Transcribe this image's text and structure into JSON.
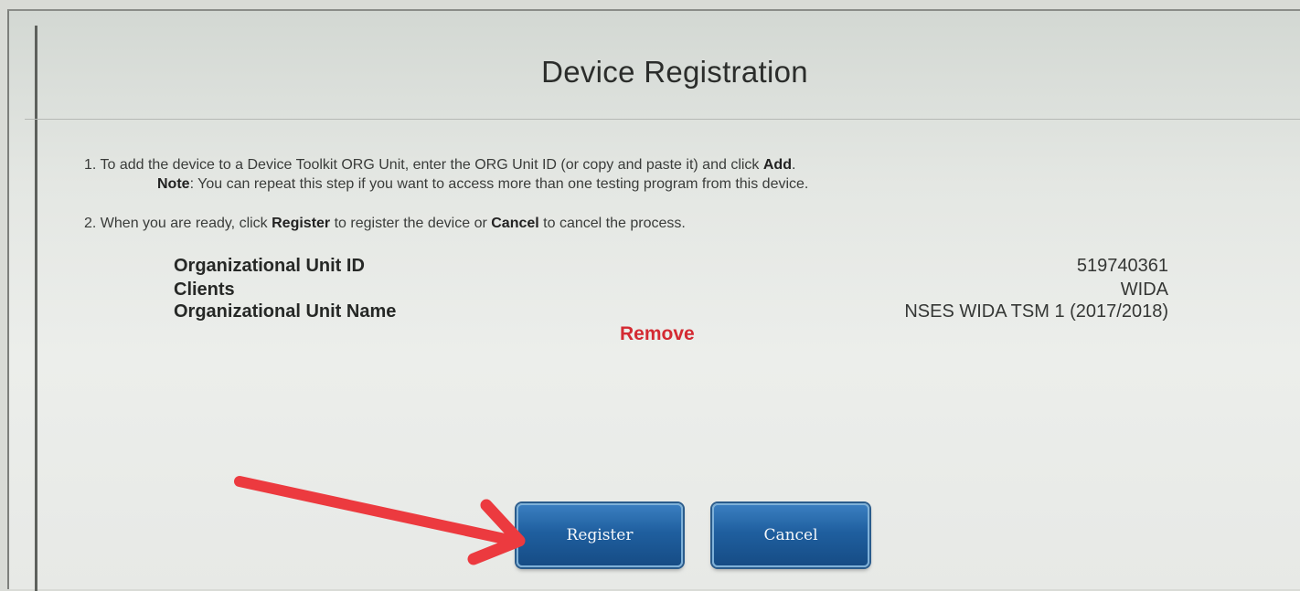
{
  "dialog": {
    "title": "Device Registration"
  },
  "instructions": {
    "step1_prefix": "1. To add the device to a Device Toolkit ORG Unit, enter the ORG Unit ID (or copy and paste it) and click ",
    "step1_bold": "Add",
    "step1_suffix": ".",
    "note_label": "Note",
    "note_text": ": You can repeat this step if you want to access more than one testing program from this device.",
    "step2_prefix": "2. When you are ready, click ",
    "step2_register": "Register",
    "step2_middle": " to register the device or ",
    "step2_cancel": "Cancel",
    "step2_suffix": " to cancel the process."
  },
  "org_unit": {
    "id_label": "Organizational Unit ID",
    "id_value": "519740361",
    "clients_label": "Clients",
    "clients_value": "WIDA",
    "name_label": "Organizational Unit Name",
    "name_value": "NSES WIDA TSM 1 (2017/2018)",
    "remove_label": "Remove"
  },
  "buttons": {
    "register": "Register",
    "cancel": "Cancel"
  },
  "colors": {
    "remove": "#d42a32",
    "button": "#1f5f9f",
    "annotation_arrow": "#ec3a3f"
  },
  "icons": {
    "annotation": "red-arrow-icon"
  }
}
